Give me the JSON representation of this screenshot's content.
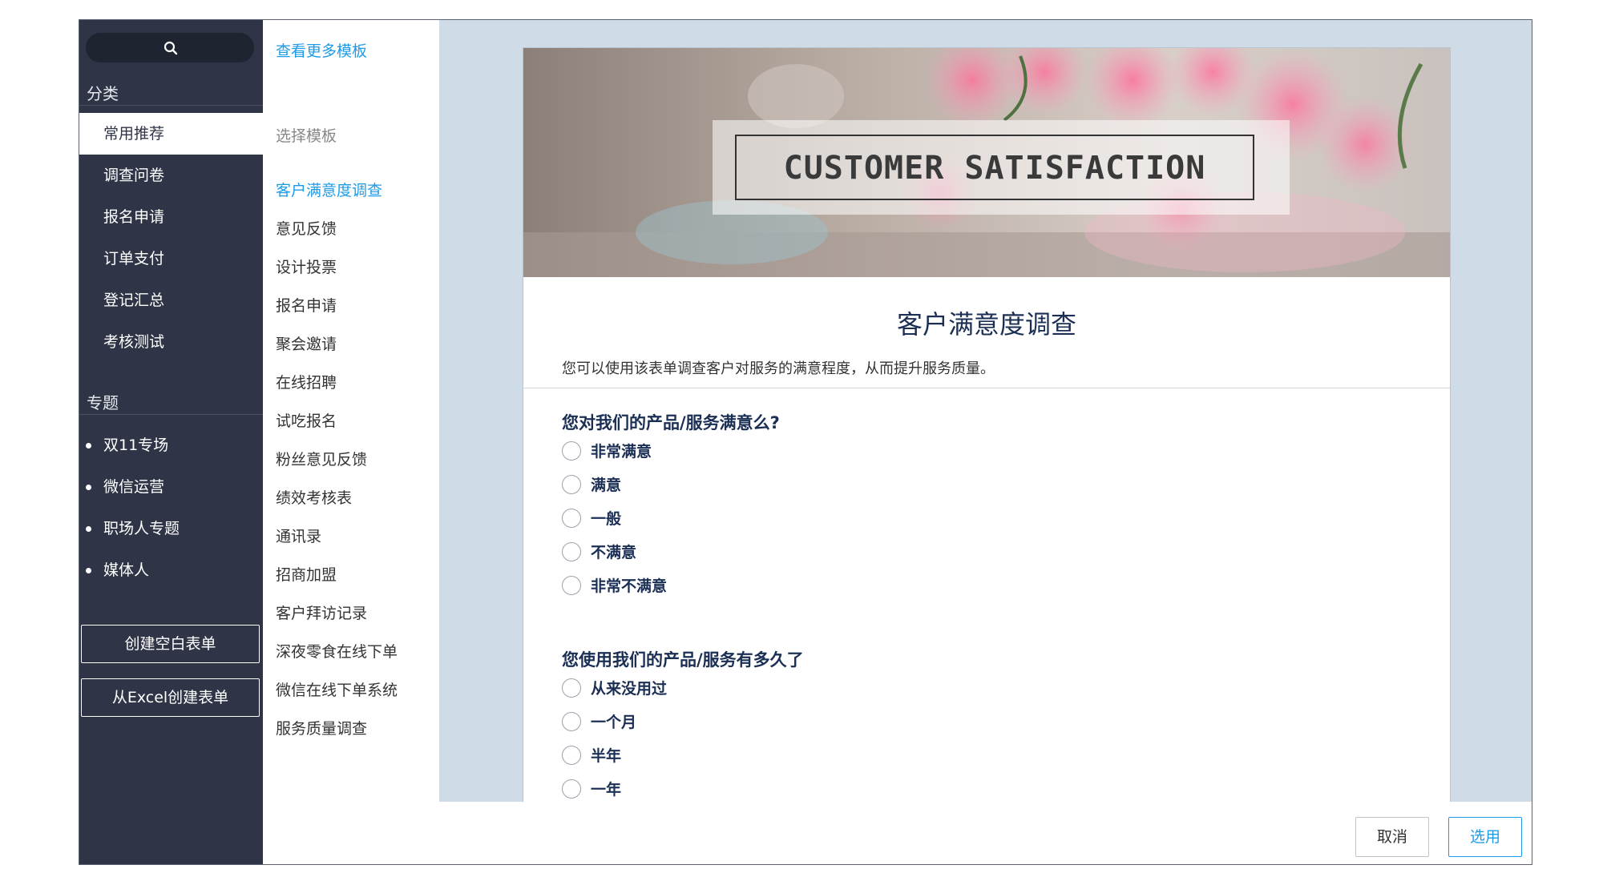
{
  "sidebar": {
    "category_title": "分类",
    "categories": [
      "常用推荐",
      "调查问卷",
      "报名申请",
      "订单支付",
      "登记汇总",
      "考核测试"
    ],
    "topic_title": "专题",
    "topics": [
      "双11专场",
      "微信运营",
      "职场人专题",
      "媒体人"
    ],
    "create_blank": "创建空白表单",
    "create_excel": "从Excel创建表单"
  },
  "templates": {
    "more": "查看更多模板",
    "heading": "选择模板",
    "items": [
      "客户满意度调查",
      "意见反馈",
      "设计投票",
      "报名申请",
      "聚会邀请",
      "在线招聘",
      "试吃报名",
      "粉丝意见反馈",
      "绩效考核表",
      "通讯录",
      "招商加盟",
      "客户拜访记录",
      "深夜零食在线下单",
      "微信在线下单系统",
      "服务质量调查"
    ]
  },
  "preview": {
    "banner_text": "CUSTOMER SATISFACTION",
    "title": "客户满意度调查",
    "description": "您可以使用该表单调查客户对服务的满意程度，从而提升服务质量。",
    "q1": {
      "label": "您对我们的产品/服务满意么?",
      "options": [
        "非常满意",
        "满意",
        "一般",
        "不满意",
        "非常不满意"
      ]
    },
    "q2": {
      "label": "您使用我们的产品/服务有多久了",
      "options": [
        "从来没用过",
        "一个月",
        "半年",
        "一年"
      ]
    }
  },
  "footer": {
    "cancel": "取消",
    "use": "选用"
  },
  "colors": {
    "sidebar_bg": "#2f3546",
    "accent": "#1e9be8",
    "preview_bg": "#cfdbe6",
    "form_text": "#1b2f54"
  }
}
